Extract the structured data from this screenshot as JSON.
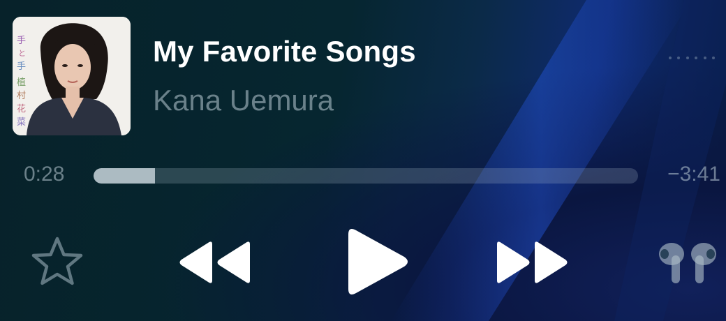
{
  "song": {
    "title": "My Favorite Songs",
    "artist": "Kana Uemura"
  },
  "album_art": {
    "vertical_text": "手と手植村花菜",
    "subject": "portrait"
  },
  "playback": {
    "elapsed": "0:28",
    "remaining": "−3:41",
    "progress_fraction": 0.113
  },
  "controls": {
    "favorite_icon": "star-outline-icon",
    "previous_icon": "rewind-icon",
    "play_icon": "play-icon",
    "next_icon": "fast-forward-icon",
    "output_icon": "airpods-pro-icon",
    "more_icon": "more-dots-icon"
  },
  "colors": {
    "background": "#07222a",
    "accent_blue": "#0f2a70",
    "text_primary": "#ffffff",
    "text_secondary": "#8fa3ad"
  }
}
